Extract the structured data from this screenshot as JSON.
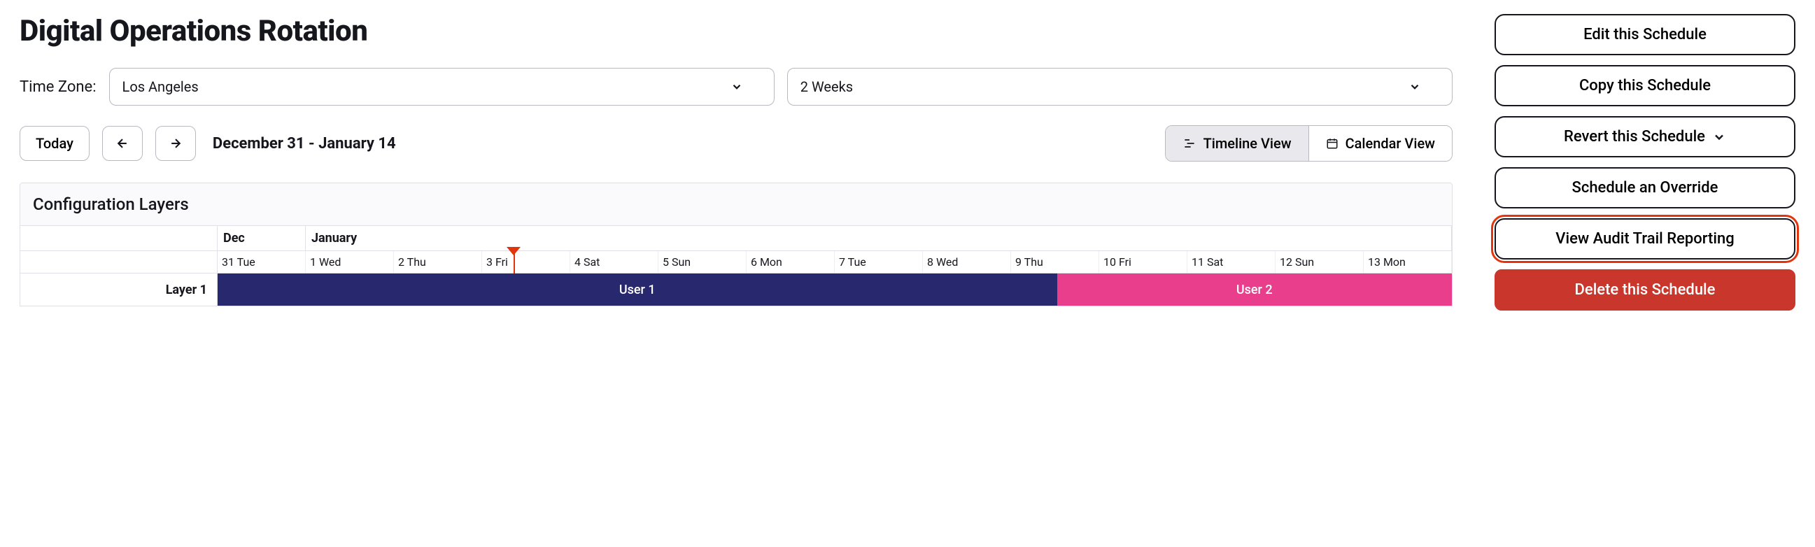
{
  "page_title": "Digital Operations Rotation",
  "timezone": {
    "label": "Time Zone:",
    "value": "Los Angeles"
  },
  "range_select": {
    "value": "2 Weeks"
  },
  "nav": {
    "today_label": "Today",
    "date_range": "December 31 - January 14"
  },
  "view_toggle": {
    "timeline": "Timeline View",
    "calendar": "Calendar View"
  },
  "layers": {
    "header": "Configuration Layers",
    "months": [
      "Dec",
      "January"
    ],
    "days": [
      "31 Tue",
      "1 Wed",
      "2 Thu",
      "3 Fri",
      "4 Sat",
      "5 Sun",
      "6 Mon",
      "7 Tue",
      "8 Wed",
      "9 Thu",
      "10 Fri",
      "11 Sat",
      "12 Sun",
      "13 Mon"
    ],
    "row_label": "Layer 1",
    "bars": [
      {
        "label": "User 1",
        "color": "navy"
      },
      {
        "label": "User 2",
        "color": "pink"
      }
    ]
  },
  "actions": {
    "edit": "Edit this Schedule",
    "copy": "Copy this Schedule",
    "revert": "Revert this Schedule",
    "override": "Schedule an Override",
    "audit": "View Audit Trail Reporting",
    "delete": "Delete this Schedule"
  }
}
